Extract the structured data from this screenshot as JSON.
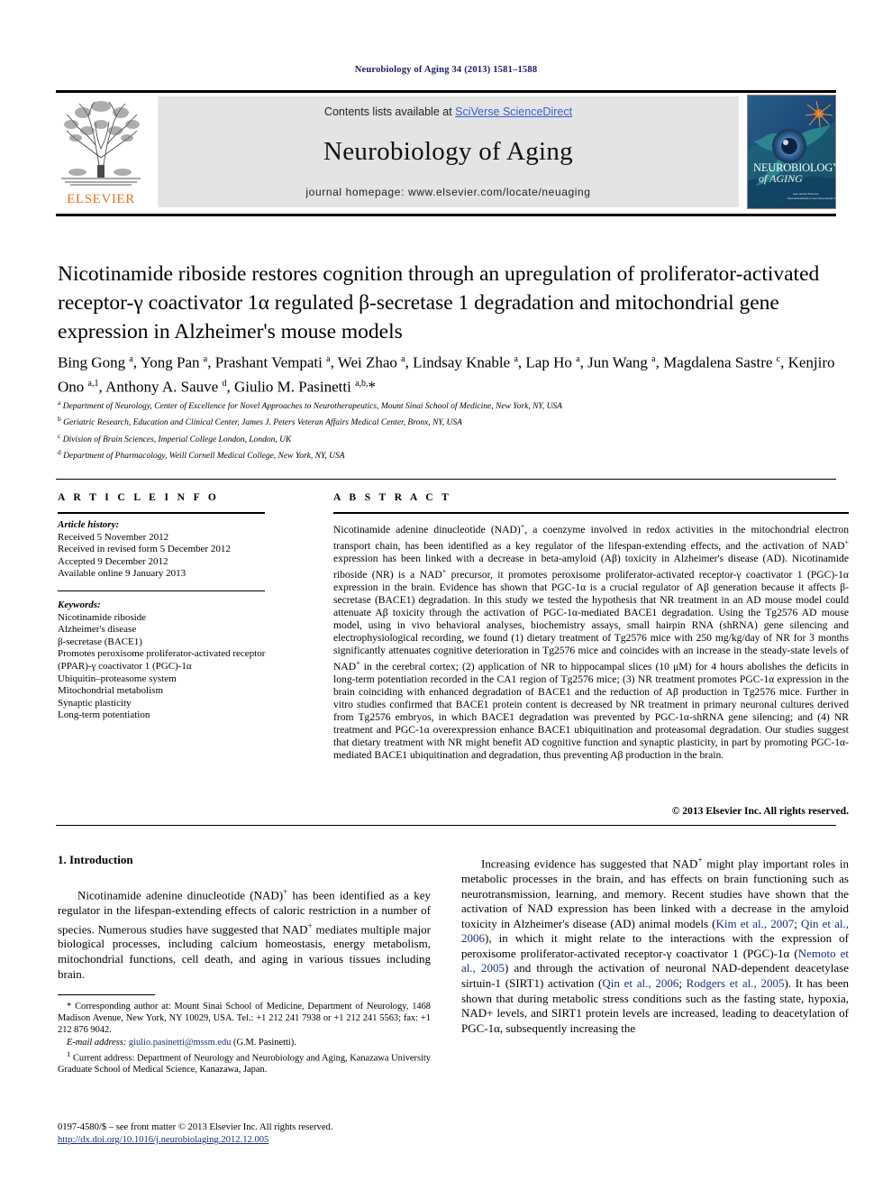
{
  "running_head": "Neurobiology of Aging 34 (2013) 1581–1588",
  "masthead": {
    "contents_prefix": "Contents lists available at ",
    "sciencedirect": "SciVerse ScienceDirect",
    "journal_title": "Neurobiology of Aging",
    "homepage": "journal homepage: www.elsevier.com/locate/neuaging",
    "publisher_logo_text": "ELSEVIER",
    "cover_title_line1": "NEUROBIOLOGY",
    "cover_title_line2": "of AGING",
    "cover_subtitle": "Age-related Neurons, Neuroinflammation and Neurometabolism",
    "colors": {
      "band_bg": "#e4e4e4",
      "link": "#3a5fcd",
      "elsevier_orange": "#E9711C",
      "cover_bg": "#1b3f6b"
    }
  },
  "article": {
    "title": "Nicotinamide riboside restores cognition through an upregulation of proliferator-activated receptor-γ coactivator 1α regulated β-secretase 1 degradation and mitochondrial gene expression in Alzheimer's mouse models",
    "authors_html": "Bing Gong <sup>a</sup>, Yong Pan <sup>a</sup>, Prashant Vempati <sup>a</sup>, Wei Zhao <sup>a</sup>, Lindsay Knable <sup>a</sup>, Lap Ho <sup>a</sup>, Jun Wang <sup>a</sup>, Magdalena Sastre <sup>c</sup>, Kenjiro Ono <sup>a,1</sup>, Anthony A. Sauve <sup>d</sup>, Giulio M. Pasinetti <sup>a,b,</sup>*",
    "affiliations": [
      {
        "marker": "a",
        "text": "Department of Neurology, Center of Excellence for Novel Approaches to Neurotherapeutics, Mount Sinai School of Medicine, New York, NY, USA"
      },
      {
        "marker": "b",
        "text": "Geriatric Research, Education and Clinical Center, James J. Peters Veteran Affairs Medical Center, Bronx, NY, USA"
      },
      {
        "marker": "c",
        "text": "Division of Brain Sciences, Imperial College London, London, UK"
      },
      {
        "marker": "d",
        "text": "Department of Pharmacology, Weill Cornell Medical College, New York, NY, USA"
      }
    ]
  },
  "article_info": {
    "heading": "A R T I C L E  I N F O",
    "history_label": "Article history:",
    "history": [
      "Received 5 November 2012",
      "Received in revised form 5 December 2012",
      "Accepted 9 December 2012",
      "Available online 9 January 2013"
    ],
    "keywords_label": "Keywords:",
    "keywords": [
      "Nicotinamide riboside",
      "Alzheimer's disease",
      "β-secretase (BACE1)",
      "Promotes peroxisome proliferator-activated receptor (PPAR)-γ coactivator 1 (PGC)-1α",
      "Ubiquitin–proteasome system",
      "Mitochondrial metabolism",
      "Synaptic plasticity",
      "Long-term potentiation"
    ]
  },
  "abstract": {
    "heading": "A B S T R A C T",
    "text_html": "Nicotinamide adenine dinucleotide (NAD)<sup>+</sup>, a coenzyme involved in redox activities in the mitochondrial electron transport chain, has been identified as a key regulator of the lifespan-extending effects, and the activation of NAD<sup>+</sup> expression has been linked with a decrease in beta-amyloid (Aβ) toxicity in Alzheimer's disease (AD). Nicotinamide riboside (NR) is a NAD<sup>+</sup> precursor, it promotes peroxisome proliferator-activated receptor-γ coactivator 1 (PGC)-1α expression in the brain. Evidence has shown that PGC-1α is a crucial regulator of Aβ generation because it affects β-secretase (BACE1) degradation. In this study we tested the hypothesis that NR treatment in an AD mouse model could attenuate Aβ toxicity through the activation of PGC-1α-mediated BACE1 degradation. Using the Tg2576 AD mouse model, using in vivo behavioral analyses, biochemistry assays, small hairpin RNA (shRNA) gene silencing and electrophysiological recording, we found (1) dietary treatment of Tg2576 mice with 250 mg/kg/day of NR for 3 months significantly attenuates cognitive deterioration in Tg2576 mice and coincides with an increase in the steady-state levels of NAD<sup>+</sup> in the cerebral cortex; (2) application of NR to hippocampal slices (10 μM) for 4 hours abolishes the deficits in long-term potentiation recorded in the CA1 region of Tg2576 mice; (3) NR treatment promotes PGC-1α expression in the brain coinciding with enhanced degradation of BACE1 and the reduction of Aβ production in Tg2576 mice. Further in vitro studies confirmed that BACE1 protein content is decreased by NR treatment in primary neuronal cultures derived from Tg2576 embryos, in which BACE1 degradation was prevented by PGC-1α-shRNA gene silencing; and (4) NR treatment and PGC-1α overexpression enhance BACE1 ubiquitination and proteasomal degradation. Our studies suggest that dietary treatment with NR might benefit AD cognitive function and synaptic plasticity, in part by promoting PGC-1α-mediated BACE1 ubiquitination and degradation, thus preventing Aβ production in the brain.",
    "copyright": "© 2013 Elsevier Inc. All rights reserved."
  },
  "body": {
    "section_heading": "1. Introduction",
    "left_paragraph_html": "Nicotinamide adenine dinucleotide (NAD)<sup>+</sup> has been identified as a key regulator in the lifespan-extending effects of caloric restriction in a number of species. Numerous studies have suggested that NAD<sup>+</sup> mediates multiple major biological processes, including calcium homeostasis, energy metabolism, mitochondrial functions, cell death, and aging in various tissues including brain.",
    "right_paragraph_html": "Increasing evidence has suggested that NAD<sup>+</sup> might play important roles in metabolic processes in the brain, and has effects on brain functioning such as neurotransmission, learning, and memory. Recent studies have shown that the activation of NAD expression has been linked with a decrease in the amyloid toxicity in Alzheimer's disease (AD) animal models (<span class=\"cite\">Kim et al., 2007</span>; <span class=\"cite\">Qin et al., 2006</span>), in which it might relate to the interactions with the expression of peroxisome proliferator-activated receptor-γ coactivator 1 (PGC)-1α (<span class=\"cite\">Nemoto et al., 2005</span>) and through the activation of neuronal NAD-dependent deacetylase sirtuin-1 (SIRT1) activation (<span class=\"cite\">Qin et al., 2006</span>; <span class=\"cite\">Rodgers et al., 2005</span>). It has been shown that during metabolic stress conditions such as the fasting state, hypoxia, NAD+ levels, and SIRT1 protein levels are increased, leading to deacetylation of PGC-1α, subsequently increasing the"
  },
  "footnotes": {
    "corresponding_html": "* Corresponding author at: Mount Sinai School of Medicine, Department of Neurology, 1468 Madison Avenue, New York, NY 10029, USA. Tel.: +1 212 241 7938 or +1 212 241 5563; fax: +1 212 876 9042.",
    "email_label": "E-mail address:",
    "email": "giulio.pasinetti@mssm.edu",
    "email_owner": "(G.M. Pasinetti).",
    "current_address_html": "<sup>1</sup> Current address: Department of Neurology and Neurobiology and Aging, Kanazawa University Graduate School of Medical Science, Kanazawa, Japan."
  },
  "imprint": {
    "line1": "0197-4580/$ – see front matter © 2013 Elsevier Inc. All rights reserved.",
    "doi": "http://dx.doi.org/10.1016/j.neurobiolaging.2012.12.005"
  }
}
